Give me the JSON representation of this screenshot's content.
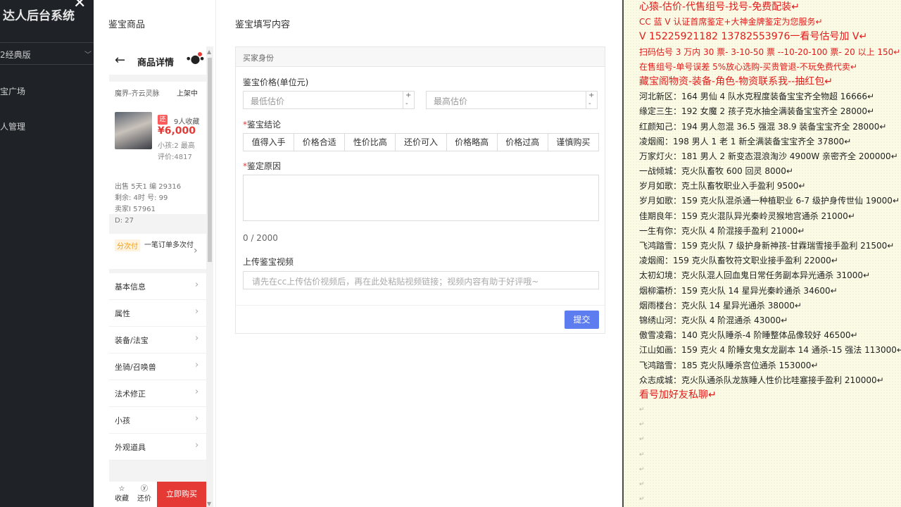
{
  "sidebar": {
    "app_title": "达人后台系统",
    "version_select": "2经典版",
    "items": [
      "宝广场",
      "人管理"
    ]
  },
  "modal": {
    "preview_heading": "鉴宝商品",
    "form_heading": "鉴宝填写内容",
    "phone": {
      "title": "商品详情",
      "server": "魔界-齐云灵脉",
      "status": "上架中",
      "tag": "还",
      "favorites": "9人收藏",
      "price": "¥6,000",
      "kids": "小孩:2 最高",
      "evaluation": "评价:4817",
      "stats": [
        "出售    5天1     编   29316",
        "剩余:   4时      号:       99",
        "卖家I  57961",
        "D:     27"
      ],
      "installment_badge": "分次付",
      "installment_text": "一笔订单多次付",
      "menu": [
        "基本信息",
        "属性",
        "装备/法宝",
        "坐骑/召唤兽",
        "法术修正",
        "小孩",
        "外观道具"
      ],
      "footer": {
        "favorite": "收藏",
        "bargain": "还价",
        "buy": "立即购买"
      }
    },
    "form": {
      "section_title": "买家身份",
      "price_label": "鉴宝价格(单位元)",
      "min_placeholder": "最低估价",
      "max_placeholder": "最高估价",
      "conclusion_label": "鉴宝结论",
      "conclusion_options": [
        "值得入手",
        "价格合适",
        "性价比高",
        "还价可入",
        "价格略高",
        "价格过高",
        "谨慎购买"
      ],
      "reason_label": "鉴定原因",
      "counter": "0 / 2000",
      "video_label": "上传鉴宝视频",
      "video_placeholder": "请先在cc上传估价视频后，再在此处粘贴视频链接；视频内容有助于好评哦~",
      "submit": "提交"
    }
  },
  "document": {
    "lines": [
      {
        "text": "心猿-估价-代售组号-找号-免费配装↵",
        "style": "red big"
      },
      {
        "text": "CC 蓝 V 认证首席鉴定+大神金牌鉴定为您服务↵",
        "style": "red"
      },
      {
        "text": "V 15225921182     13782553976一看号估号加 V↵",
        "style": "red big"
      },
      {
        "text": "扫码估号 3 万内 30 票- 3-10-50 票  --10-20-100 票- 20 以上 150↵",
        "style": "red"
      },
      {
        "text": "在售组号-单号误差 5%放心选购-买贵管退-不玩免费代卖↵",
        "style": "red"
      },
      {
        "text": "藏宝阁物资-装备-角色-物资联系我--抽红包↵",
        "style": "red big"
      },
      {
        "text": "河北新区：164 男仙 4 队水克程度装备宝宝齐全物超 16666↵",
        "style": "blk"
      },
      {
        "text": "缘定三生：192 女魔 2 孩子克水抽全满装备宝宝齐全 28000↵",
        "style": "blk"
      },
      {
        "text": "红颜知己：194 男人忽混 36.5 强混 38.9 装备宝宝齐全 28000↵",
        "style": "blk"
      },
      {
        "text": "凌烟阁：198 男人 1 老 1 新全满装备宝宝齐全 37800↵",
        "style": "blk"
      },
      {
        "text": "万家灯火：181 男人 2 新变态混浪淘沙 4900W 亲密齐全 200000↵",
        "style": "blk"
      },
      {
        "text": "一战倾城：克火队畜牧 600 回灵 8000↵",
        "style": "blk"
      },
      {
        "text": "岁月如歌：克土队畜牧职业入手盈利 9500↵",
        "style": "blk"
      },
      {
        "text": "岁月如歌：159 克火队混杀通一种植职业 6-7 级护身传世仙 19000↵",
        "style": "blk"
      },
      {
        "text": "佳期良年：159 克火混队异光秦岭灵猴地宫通杀 21000↵",
        "style": "blk"
      },
      {
        "text": "一生有你：克火队 4 阶混接手盈利 21000↵",
        "style": "blk"
      },
      {
        "text": "飞鸿踏雪：159 克火队 7 级护身新神孩-甘霖瑞雪接手盈利 21500↵",
        "style": "blk"
      },
      {
        "text": "凌烟阁：159 克火队畜牧符文职业接手盈利 22000↵",
        "style": "blk"
      },
      {
        "text": "太初幻境：克火队混人回血鬼日常任务副本异光通杀 31000↵",
        "style": "blk"
      },
      {
        "text": "烟柳灞桥：159 克火队 14 星异光秦岭通杀 34600↵",
        "style": "blk"
      },
      {
        "text": "烟雨楼台：克火队 14 星异光通杀 38000↵",
        "style": "blk"
      },
      {
        "text": "锦绣山河：克火队 4 阶混通杀 43000↵",
        "style": "blk"
      },
      {
        "text": "傲雪凌霜：140 克火队睡杀-4 阶睡整体品像较好 46500↵",
        "style": "blk"
      },
      {
        "text": "江山如画：159 克火 4 阶睡女鬼女龙副本 14 通杀-15 强法 113000↵",
        "style": "blk"
      },
      {
        "text": "飞鸿踏雪：185 克火队睡杀宫位通杀 153000↵",
        "style": "blk"
      },
      {
        "text": "众志成城：克火队通杀队龙族睡人性价比哇塞接手盈利 210000↵",
        "style": "blk"
      },
      {
        "text": "看号加好友私聊↵",
        "style": "red big"
      },
      {
        "text": "↵",
        "style": "pm"
      },
      {
        "text": "↵",
        "style": "pm"
      },
      {
        "text": "↵",
        "style": "pm"
      },
      {
        "text": "↵",
        "style": "pm"
      },
      {
        "text": "↵",
        "style": "pm"
      },
      {
        "text": "↵",
        "style": "pm"
      },
      {
        "text": "↵",
        "style": "pm"
      }
    ]
  },
  "colors": {
    "accent_red": "#e21b1b",
    "submit_blue": "#5c7cf0",
    "doc_bg": "#fbfbe6"
  }
}
